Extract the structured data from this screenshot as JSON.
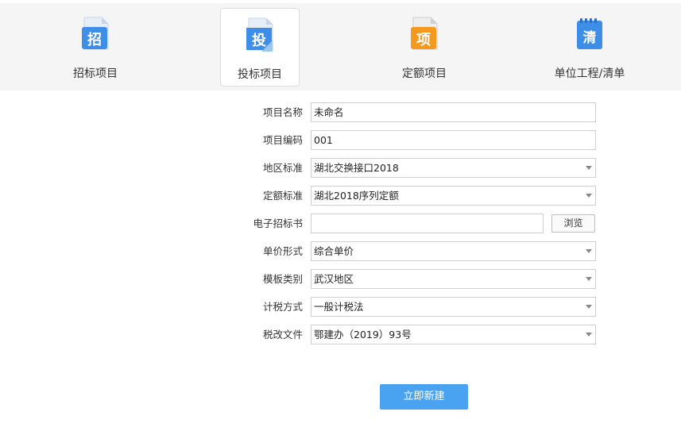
{
  "tabs": [
    {
      "label": "招标项目",
      "icon_char": "招",
      "icon": "bid-document-icon",
      "active": false
    },
    {
      "label": "投标项目",
      "icon_char": "投",
      "icon": "tender-document-icon",
      "active": true
    },
    {
      "label": "定额项目",
      "icon_char": "项",
      "icon": "quota-document-icon",
      "active": false
    },
    {
      "label": "单位工程/清单",
      "icon_char": "清",
      "icon": "bill-notepad-icon",
      "active": false
    }
  ],
  "form": {
    "project_name": {
      "label": "项目名称",
      "value": "未命名"
    },
    "project_code": {
      "label": "项目编码",
      "value": "001"
    },
    "region_standard": {
      "label": "地区标准",
      "value": "湖北交换接口2018"
    },
    "quota_standard": {
      "label": "定额标准",
      "value": "湖北2018序列定额"
    },
    "e_tender": {
      "label": "电子招标书",
      "value": "",
      "browse_label": "浏览"
    },
    "unit_price_form": {
      "label": "单价形式",
      "value": "综合单价"
    },
    "template_category": {
      "label": "模板类别",
      "value": "武汉地区"
    },
    "tax_method": {
      "label": "计税方式",
      "value": "一般计税法"
    },
    "tax_reform_file": {
      "label": "税改文件",
      "value": "鄂建办（2019）93号"
    }
  },
  "submit_label": "立即新建",
  "colors": {
    "accent": "#4aa3f0",
    "icon_blue": "#3e8ee8",
    "icon_orange": "#f39a1e",
    "topbar_bg": "#f5f5f5"
  }
}
